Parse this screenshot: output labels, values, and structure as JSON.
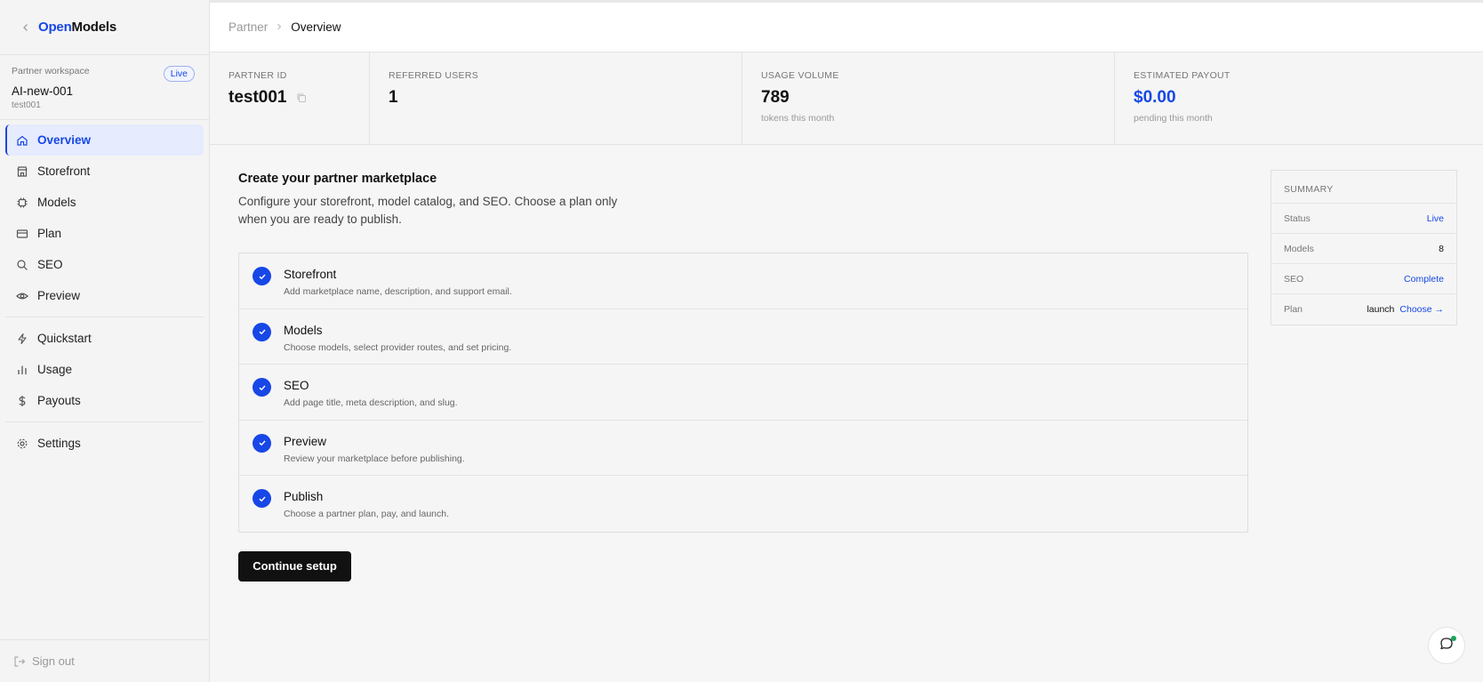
{
  "brand": {
    "part1": "Open",
    "part2": "Models"
  },
  "workspace": {
    "label": "Partner workspace",
    "badge": "Live",
    "name": "AI-new-001",
    "id": "test001"
  },
  "nav": {
    "primary": [
      {
        "label": "Overview",
        "icon": "home-icon"
      },
      {
        "label": "Storefront",
        "icon": "store-icon"
      },
      {
        "label": "Models",
        "icon": "chip-icon"
      },
      {
        "label": "Plan",
        "icon": "card-icon"
      },
      {
        "label": "SEO",
        "icon": "search-icon"
      },
      {
        "label": "Preview",
        "icon": "eye-icon"
      }
    ],
    "secondary": [
      {
        "label": "Quickstart",
        "icon": "bolt-icon"
      },
      {
        "label": "Usage",
        "icon": "bar-chart-icon"
      },
      {
        "label": "Payouts",
        "icon": "dollar-icon"
      }
    ],
    "tertiary": [
      {
        "label": "Settings",
        "icon": "gear-icon"
      }
    ]
  },
  "signout": "Sign out",
  "breadcrumb": {
    "parent": "Partner",
    "current": "Overview"
  },
  "stats": [
    {
      "label": "PARTNER ID",
      "value": "test001",
      "sub": ""
    },
    {
      "label": "REFERRED USERS",
      "value": "1",
      "sub": ""
    },
    {
      "label": "USAGE VOLUME",
      "value": "789",
      "sub": "tokens this month"
    },
    {
      "label": "ESTIMATED PAYOUT",
      "value": "$0.00",
      "sub": "pending this month"
    }
  ],
  "setup": {
    "title": "Create your partner marketplace",
    "description": "Configure your storefront, model catalog, and SEO. Choose a plan only when you are ready to publish.",
    "steps": [
      {
        "title": "Storefront",
        "desc": "Add marketplace name, description, and support email."
      },
      {
        "title": "Models",
        "desc": "Choose models, select provider routes, and set pricing."
      },
      {
        "title": "SEO",
        "desc": "Add page title, meta description, and slug."
      },
      {
        "title": "Preview",
        "desc": "Review your marketplace before publishing."
      },
      {
        "title": "Publish",
        "desc": "Choose a partner plan, pay, and launch."
      }
    ],
    "cta": "Continue setup"
  },
  "summary": {
    "heading": "SUMMARY",
    "status": {
      "key": "Status",
      "value": "Live"
    },
    "models": {
      "key": "Models",
      "value": "8"
    },
    "seo": {
      "key": "SEO",
      "value": "Complete"
    },
    "plan": {
      "key": "Plan",
      "value": "launch",
      "action": "Choose →"
    }
  },
  "colors": {
    "accent": "#1747e6",
    "dark": "#111111",
    "online": "#1aa35b"
  }
}
